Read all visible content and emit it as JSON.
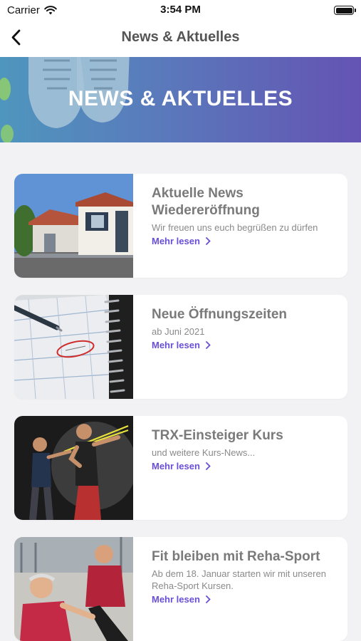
{
  "status_bar": {
    "carrier": "Carrier",
    "time": "3:54 PM"
  },
  "nav": {
    "title": "News & Aktuelles"
  },
  "hero": {
    "title": "NEWS & AKTUELLES"
  },
  "news": [
    {
      "title": "Aktuelle News Wiedereröffnung",
      "subtitle": "Wir freuen uns euch begrüßen zu dürfen",
      "link": "Mehr lesen"
    },
    {
      "title": "Neue Öffnungszeiten",
      "subtitle": "ab Juni 2021",
      "link": "Mehr lesen"
    },
    {
      "title": "TRX-Einsteiger Kurs",
      "subtitle": "und weitere Kurs-News...",
      "link": "Mehr lesen"
    },
    {
      "title": "Fit bleiben mit Reha-Sport",
      "subtitle": "Ab dem 18. Januar starten wir mit unseren Reha-Sport Kursen.",
      "link": "Mehr lesen"
    }
  ],
  "colors": {
    "accent": "#6a4fd6",
    "hero_start": "#4f96be",
    "hero_end": "#6453b3"
  },
  "icons": {
    "back": "chevron-left-icon",
    "wifi": "wifi-icon",
    "battery": "battery-icon",
    "link": "chevron-right-icon"
  }
}
